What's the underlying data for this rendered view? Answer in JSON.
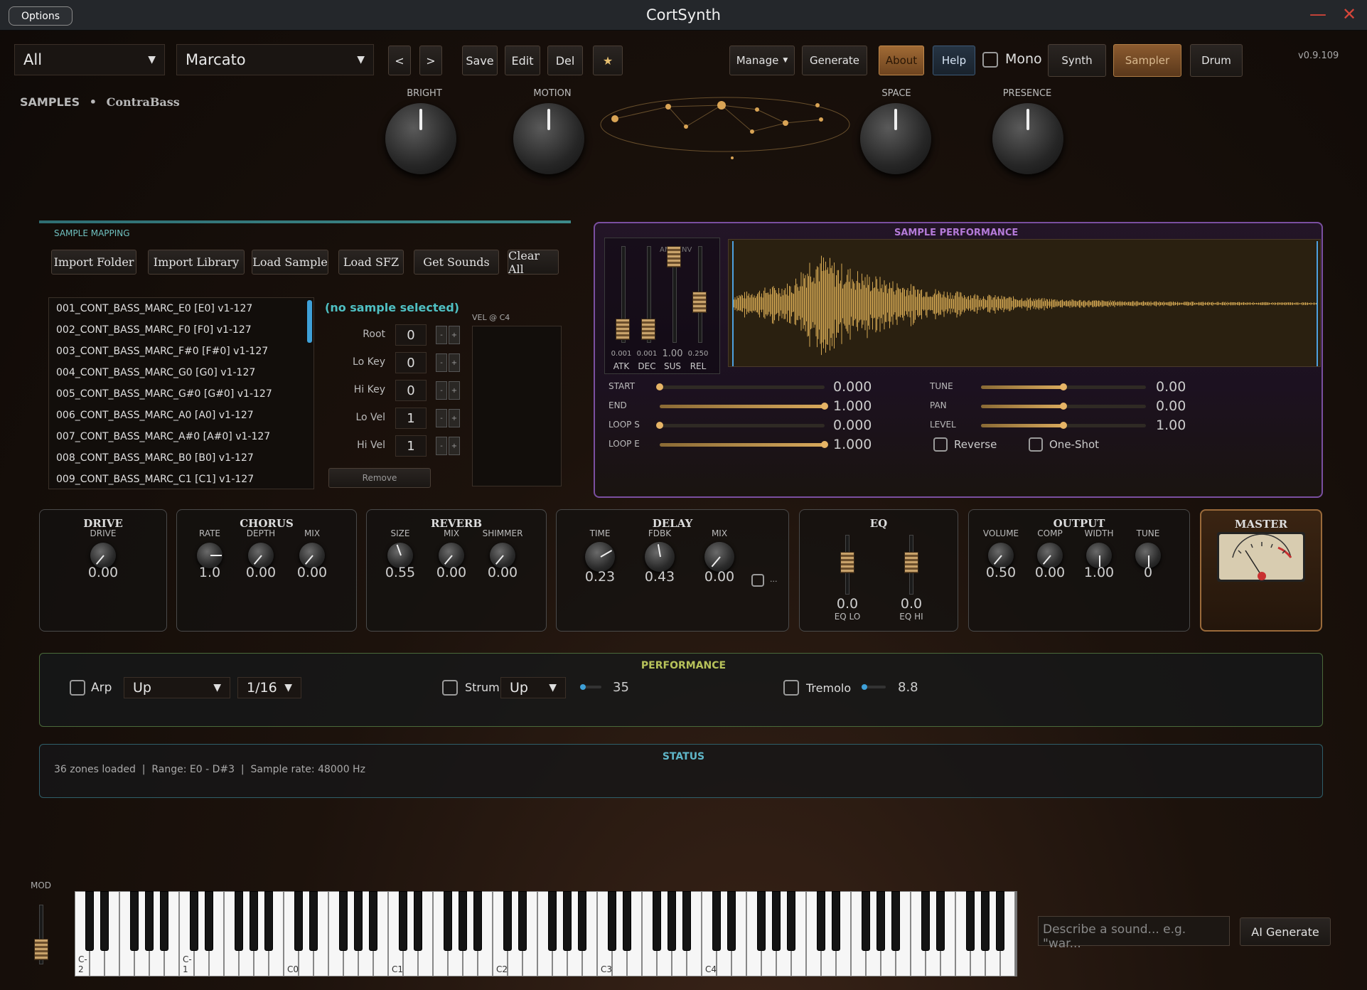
{
  "app": {
    "title": "CortSynth",
    "options": "Options",
    "version": "v0.9.109",
    "minimize": "—",
    "close": "✕"
  },
  "toolbar": {
    "category": "All",
    "preset": "Marcato",
    "prev": "<",
    "next": ">",
    "save": "Save",
    "edit": "Edit",
    "del": "Del",
    "star": "★",
    "manage": "Manage",
    "generate": "Generate",
    "about": "About",
    "help": "Help",
    "mono": "Mono",
    "synth": "Synth",
    "sampler": "Sampler",
    "drum": "Drum"
  },
  "header": {
    "section": "SAMPLES",
    "bullet": "•",
    "instrument": "ContraBass"
  },
  "macros": [
    {
      "label": "BRIGHT"
    },
    {
      "label": "MOTION"
    },
    {
      "label": "SPACE"
    },
    {
      "label": "PRESENCE"
    }
  ],
  "mapping": {
    "title": "SAMPLE MAPPING",
    "buttons": [
      "Import Folder",
      "Import Library",
      "Load Sample",
      "Load SFZ",
      "Get Sounds",
      "Clear All"
    ],
    "samples": [
      "001_CONT_BASS_MARC_E0   [E0]  v1-127",
      "002_CONT_BASS_MARC_F0   [F0]  v1-127",
      "003_CONT_BASS_MARC_F#0   [F#0]  v1-127",
      "004_CONT_BASS_MARC_G0   [G0]  v1-127",
      "005_CONT_BASS_MARC_G#0   [G#0]  v1-127",
      "006_CONT_BASS_MARC_A0   [A0]  v1-127",
      "007_CONT_BASS_MARC_A#0   [A#0]  v1-127",
      "008_CONT_BASS_MARC_B0   [B0]  v1-127",
      "009_CONT_BASS_MARC_C1   [C1]  v1-127"
    ],
    "no_selection": "(no sample selected)",
    "fields": [
      {
        "label": "Root",
        "value": "0"
      },
      {
        "label": "Lo Key",
        "value": "0"
      },
      {
        "label": "Hi Key",
        "value": "0"
      },
      {
        "label": "Lo Vel",
        "value": "1"
      },
      {
        "label": "Hi Vel",
        "value": "1"
      }
    ],
    "minus": "-",
    "plus": "+",
    "remove": "Remove",
    "vel_label": "VEL @ C4"
  },
  "performance_sample": {
    "title": "SAMPLE PERFORMANCE",
    "env_label": "AMP ENV",
    "env": [
      {
        "label": "ATK",
        "value": "0.001"
      },
      {
        "label": "DEC",
        "value": "0.001"
      },
      {
        "label": "SUS",
        "value": "1.00"
      },
      {
        "label": "REL",
        "value": "0.250"
      }
    ],
    "params_left": [
      {
        "label": "START",
        "value": "0.000",
        "level": 0.0
      },
      {
        "label": "END",
        "value": "1.000",
        "level": 1.0
      },
      {
        "label": "LOOP S",
        "value": "0.000",
        "level": 0.0
      },
      {
        "label": "LOOP E",
        "value": "1.000",
        "level": 1.0
      }
    ],
    "params_right": [
      {
        "label": "TUNE",
        "value": "0.00",
        "level": 0.5
      },
      {
        "label": "PAN",
        "value": "0.00",
        "level": 0.5
      },
      {
        "label": "LEVEL",
        "value": "1.00",
        "level": 0.5
      }
    ],
    "reverse": "Reverse",
    "oneshot": "One-Shot"
  },
  "fx": {
    "drive": {
      "title": "DRIVE",
      "knobs": [
        {
          "label": "DRIVE",
          "value": "0.00"
        }
      ]
    },
    "chorus": {
      "title": "CHORUS",
      "knobs": [
        {
          "label": "RATE",
          "value": "1.0"
        },
        {
          "label": "DEPTH",
          "value": "0.00"
        },
        {
          "label": "MIX",
          "value": "0.00"
        }
      ]
    },
    "reverb": {
      "title": "REVERB",
      "knobs": [
        {
          "label": "SIZE",
          "value": "0.55"
        },
        {
          "label": "MIX",
          "value": "0.00"
        },
        {
          "label": "SHIMMER",
          "value": "0.00"
        }
      ]
    },
    "delay": {
      "title": "DELAY",
      "knobs": [
        {
          "label": "TIME",
          "value": "0.23"
        },
        {
          "label": "FDBK",
          "value": "0.43"
        },
        {
          "label": "MIX",
          "value": "0.00"
        }
      ],
      "sync": "..."
    },
    "eq": {
      "title": "EQ",
      "faders": [
        {
          "label": "EQ LO",
          "value": "0.0"
        },
        {
          "label": "EQ HI",
          "value": "0.0"
        }
      ]
    },
    "output": {
      "title": "OUTPUT",
      "knobs": [
        {
          "label": "VOLUME",
          "value": "0.50"
        },
        {
          "label": "COMP",
          "value": "0.00"
        },
        {
          "label": "WIDTH",
          "value": "1.00"
        },
        {
          "label": "TUNE",
          "value": "0"
        }
      ]
    },
    "master": {
      "title": "MASTER"
    }
  },
  "perf": {
    "title": "PERFORMANCE",
    "arp": "Arp",
    "arp_mode": "Up",
    "arp_rate": "1/16",
    "strum": "Strum",
    "strum_mode": "Up",
    "strum_value": "35",
    "tremolo": "Tremolo",
    "tremolo_value": "8.8"
  },
  "status": {
    "title": "STATUS",
    "text": "36 zones loaded  |  Range: E0 - D#3  |  Sample rate: 48000 Hz"
  },
  "keyboard": {
    "mod": "MOD",
    "labels": [
      "C-2",
      "C-1",
      "C0",
      "C1",
      "C2",
      "C3",
      "C4"
    ]
  },
  "ai": {
    "placeholder": "Describe a sound... e.g. \"war...",
    "button": "AI Generate"
  }
}
